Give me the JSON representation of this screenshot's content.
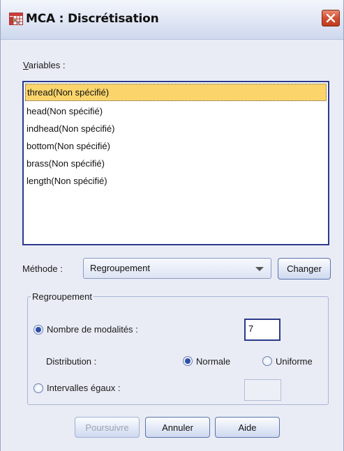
{
  "window": {
    "title": "MCA : Discrétisation",
    "close_icon": "close-x-icon",
    "app_icon": "spss-grid-icon"
  },
  "variables": {
    "label": "Variables :",
    "items": [
      {
        "label": "thread(Non spécifié)",
        "selected": true
      },
      {
        "label": "head(Non spécifié)",
        "selected": false
      },
      {
        "label": "indhead(Non spécifié)",
        "selected": false
      },
      {
        "label": "bottom(Non spécifié)",
        "selected": false
      },
      {
        "label": "brass(Non spécifié)",
        "selected": false
      },
      {
        "label": "length(Non spécifié)",
        "selected": false
      }
    ]
  },
  "method": {
    "label": "Méthode :",
    "selected": "Regroupement",
    "change_button": "Changer"
  },
  "grouping": {
    "title": "Regroupement",
    "num_categories_label": "Nombre de modalités :",
    "num_categories_value": "7",
    "num_categories_checked": true,
    "distribution_label": "Distribution :",
    "normal_label": "Normale",
    "normal_checked": true,
    "uniform_label": "Uniforme",
    "uniform_checked": false,
    "equal_intervals_label": "Intervalles égaux :",
    "equal_intervals_checked": false,
    "equal_intervals_value": ""
  },
  "buttons": {
    "continue": "Poursuivre",
    "cancel": "Annuler",
    "help": "Aide"
  },
  "colors": {
    "selection_highlight": "#fbd56b",
    "focus_border": "#2b3a8a",
    "radio_dot": "#2e4fa8",
    "close_button": "#d34f30"
  }
}
